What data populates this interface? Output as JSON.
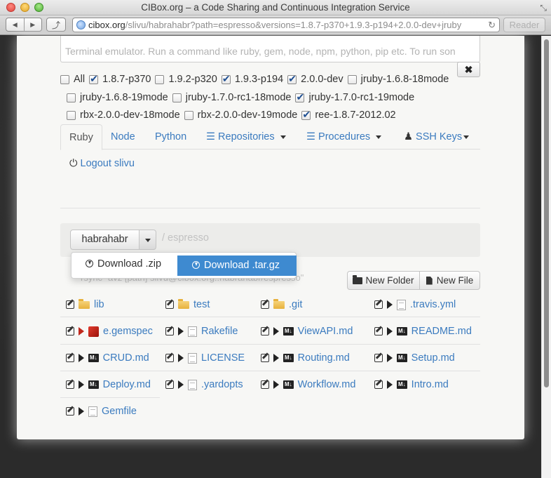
{
  "window": {
    "title": "CIBox.org – a Code Sharing and Continuous Integration Service",
    "url_host": "cibox.org",
    "url_path": "/slivu/habrahabr?path=espresso&versions=1.8.7-p370+1.9.3-p194+2.0.0-dev+jruby",
    "reader_label": "Reader"
  },
  "terminal": {
    "placeholder": "Terminal emulator. Run a command like ruby, gem, node, npm, python, pip etc. To run son",
    "clear_label": "✖"
  },
  "versions": {
    "all_label": "All",
    "items": [
      {
        "label": "1.8.7-p370",
        "checked": true
      },
      {
        "label": "1.9.2-p320",
        "checked": false
      },
      {
        "label": "1.9.3-p194",
        "checked": true
      },
      {
        "label": "2.0.0-dev",
        "checked": true
      },
      {
        "label": "jruby-1.6.8-18mode",
        "checked": false
      },
      {
        "label": "jruby-1.6.8-19mode",
        "checked": false
      },
      {
        "label": "jruby-1.7.0-rc1-18mode",
        "checked": false
      },
      {
        "label": "jruby-1.7.0-rc1-19mode",
        "checked": true
      },
      {
        "label": "rbx-2.0.0-dev-18mode",
        "checked": false
      },
      {
        "label": "rbx-2.0.0-dev-19mode",
        "checked": false
      },
      {
        "label": "ree-1.8.7-2012.02",
        "checked": true
      }
    ]
  },
  "tabs": {
    "ruby": "Ruby",
    "node": "Node",
    "python": "Python",
    "repositories": "Repositories",
    "procedures": "Procedures",
    "ssh_keys": "SSH Keys",
    "logout": "Logout slivu"
  },
  "browser": {
    "user": "habrahabr",
    "path_sep": "/ espresso",
    "download_zip": "Download .zip",
    "download_tgz": "Download .tar.gz",
    "rsync_hint": "rsync -avz [path] slivu@cibox.org::habrahabr/espresso\"",
    "new_folder": "New Folder",
    "new_file": "New File"
  },
  "files": [
    {
      "name": "lib",
      "type": "folder"
    },
    {
      "name": "test",
      "type": "folder"
    },
    {
      "name": ".git",
      "type": "folder"
    },
    {
      "name": ".travis.yml",
      "type": "file"
    },
    {
      "name": "e.gemspec",
      "type": "gemspec"
    },
    {
      "name": "Rakefile",
      "type": "file"
    },
    {
      "name": "ViewAPI.md",
      "type": "markdown"
    },
    {
      "name": "README.md",
      "type": "markdown"
    },
    {
      "name": "CRUD.md",
      "type": "markdown"
    },
    {
      "name": "LICENSE",
      "type": "file"
    },
    {
      "name": "Routing.md",
      "type": "markdown"
    },
    {
      "name": "Setup.md",
      "type": "markdown"
    },
    {
      "name": "Deploy.md",
      "type": "markdown"
    },
    {
      "name": ".yardopts",
      "type": "file"
    },
    {
      "name": "Workflow.md",
      "type": "markdown"
    },
    {
      "name": "Intro.md",
      "type": "markdown"
    },
    {
      "name": "Gemfile",
      "type": "file"
    }
  ],
  "colors": {
    "link": "#3b7bbf",
    "accent": "#3e8ad0"
  }
}
